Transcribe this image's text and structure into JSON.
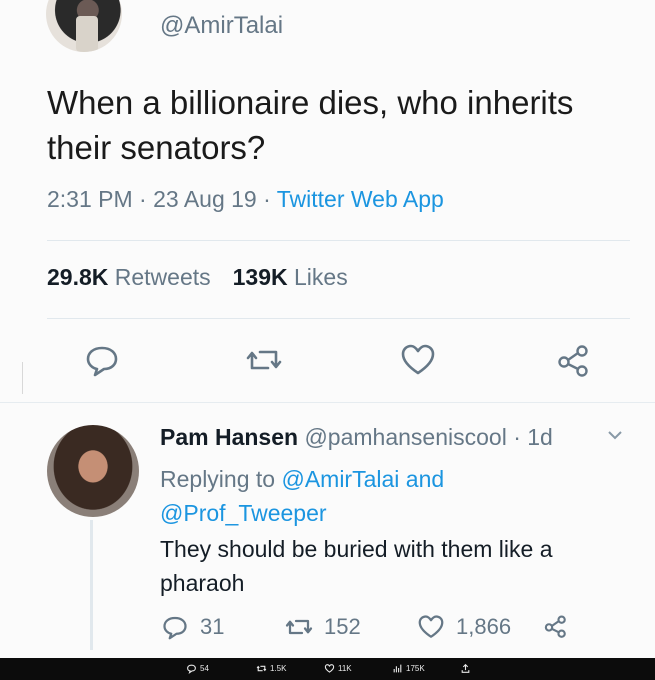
{
  "tweet": {
    "handle": "@AmirTalai",
    "text": "When a billionaire dies, who inherits their senators?",
    "time": "2:31 PM",
    "sep1": " · ",
    "date": "23 Aug 19",
    "sep2": " · ",
    "app": "Twitter Web App",
    "retweets_count": "29.8K",
    "retweets_label": "Retweets",
    "likes_count": "139K",
    "likes_label": "Likes"
  },
  "reply": {
    "name": "Pam Hansen",
    "handle": "@pamhanseniscool",
    "age": " · 1d",
    "replying_prefix": "Replying to ",
    "mention1": "@AmirTalai",
    "and": " and",
    "mention2": "@Prof_Tweeper",
    "text": "They should be buried with them like a pharaoh",
    "reply_count": "31",
    "retweet_count": "152",
    "like_count": "1,866"
  },
  "bottom_bar": {
    "replies": "54",
    "retweets": "1.5K",
    "likes": "11K",
    "views": "175K"
  },
  "colors": {
    "link": "#1b95e0",
    "muted": "#657786",
    "text": "#141d26"
  },
  "icons": [
    "reply-icon",
    "retweet-icon",
    "like-icon",
    "share-icon",
    "chevron-down-icon",
    "views-icon",
    "upload-icon"
  ]
}
